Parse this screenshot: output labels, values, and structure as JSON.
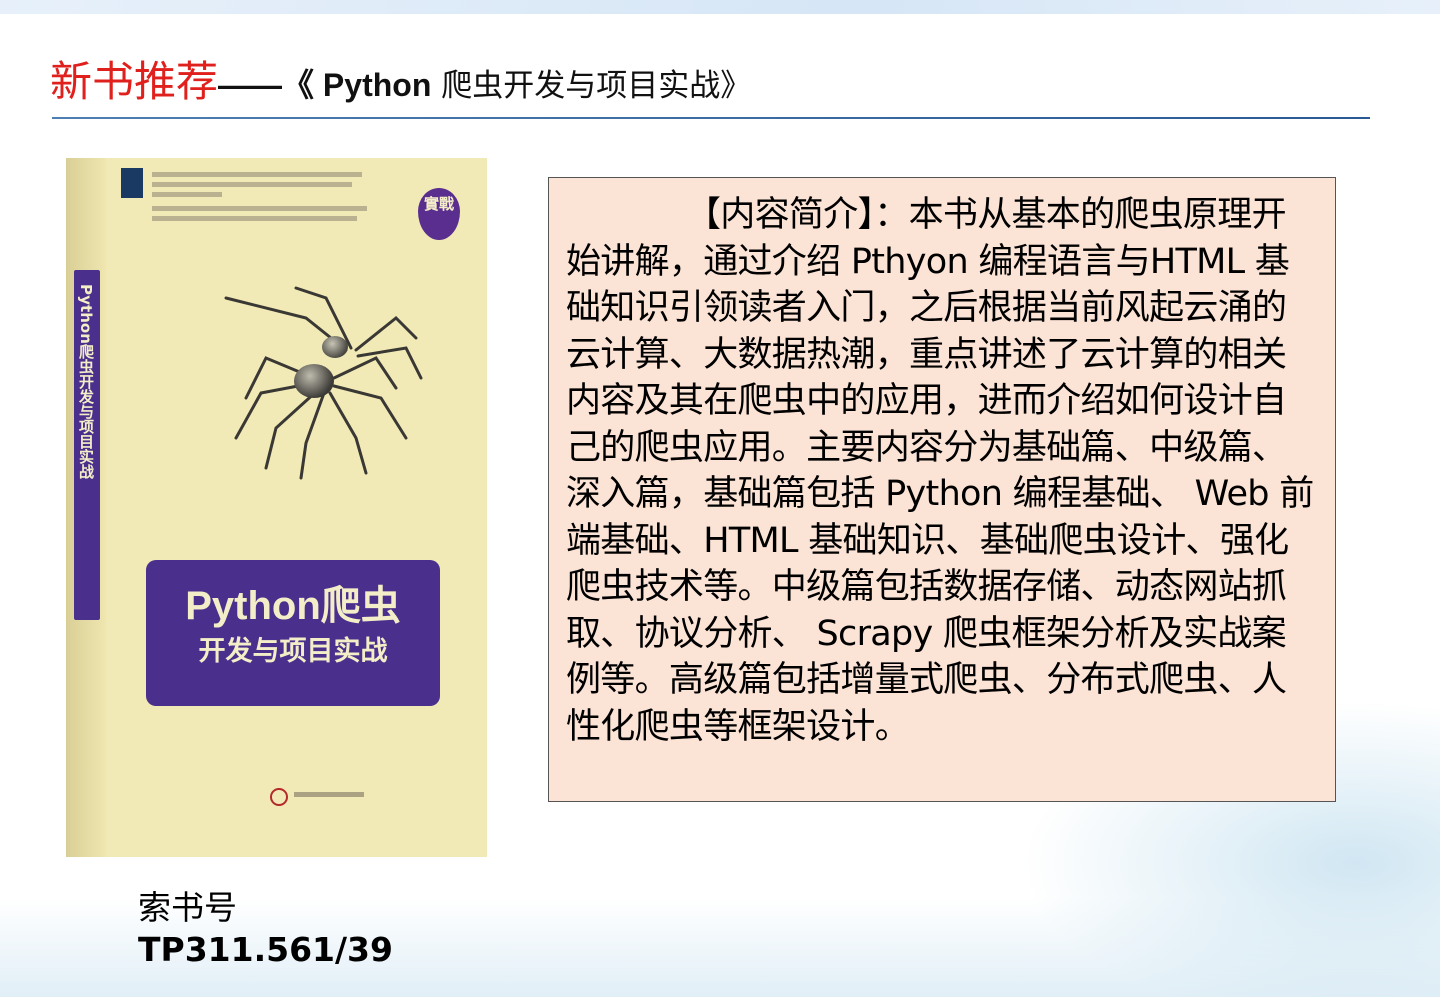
{
  "slide": {
    "title_red": "新书推荐",
    "title_dash": "——《 ",
    "title_book_en": "Python",
    "title_book_cn": " 爬虫开发与项目实战》"
  },
  "book_cover": {
    "spine_title": "Python爬虫开发与项目实战",
    "badge": "實戰",
    "cover_title_line1": "Python爬虫",
    "cover_title_line2": "开发与项目实战"
  },
  "summary": {
    "text": "【内容简介】：本书从基本的爬虫原理开始讲解，通过介绍 Pthyon 编程语言与HTML 基础知识引领读者入门，之后根据当前风起云涌的云计算、大数据热潮，重点讲述了云计算的相关内容及其在爬虫中的应用，进而介绍如何设计自己的爬虫应用。主要内容分为基础篇、中级篇、深入篇，基础篇包括 Python 编程基础、 Web 前端基础、HTML 基础知识、基础爬虫设计、强化爬虫技术等。中级篇包括数据存储、动态网站抓取、协议分析、 Scrapy 爬虫框架分析及实战案例等。高级篇包括增量式爬虫、分布式爬虫、人性化爬虫等框架设计。"
  },
  "call_number": {
    "label": "索书号",
    "value": "TP311.561/39"
  },
  "colors": {
    "title_red": "#e0201c",
    "summary_bg": "#fbe3d6",
    "cover_bg": "#f2eab6",
    "cover_purple": "#4a2f8c",
    "rule_blue": "#2a5a94"
  }
}
